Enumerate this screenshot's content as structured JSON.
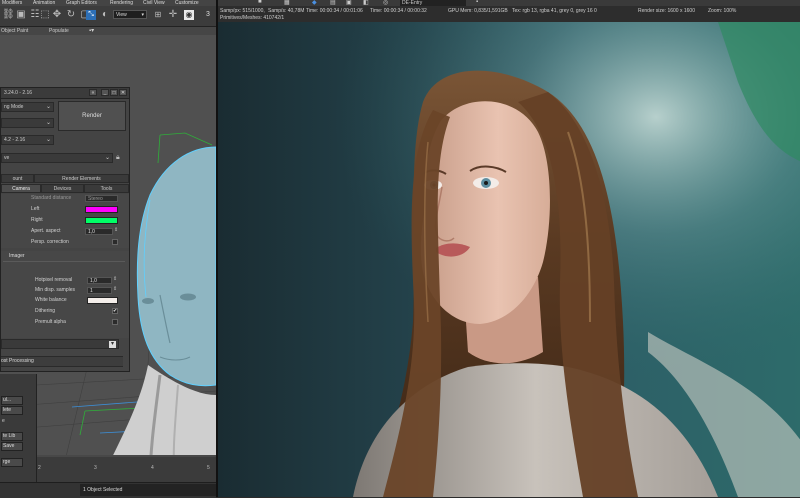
{
  "menubar": {
    "items": [
      "Modifiers",
      "Animation",
      "Graph Editors",
      "Rendering",
      "Civil View",
      "Customize"
    ]
  },
  "toolbar": {
    "view_select": "View",
    "frame_number": "3"
  },
  "ribbon": {
    "items": [
      "Object Paint",
      "Populate"
    ]
  },
  "viewport": {
    "ruler_ticks": [
      "2",
      "3",
      "4",
      "5"
    ]
  },
  "status": {
    "selection": "1 Object Selected"
  },
  "dialog": {
    "title": "3.24.0 - 2.16",
    "mode_dropdown": "ng Mode",
    "version_dropdown": "4.2 - 2.16",
    "preset_dropdown": "ve",
    "render_label": "Render",
    "tabs_row1": [
      "ount",
      "Render Elements"
    ],
    "tabs_row2": [
      "Camera",
      "Devices",
      "Tools"
    ],
    "stereo": {
      "rows": [
        {
          "label": "Standard distance",
          "value": "Stereo"
        },
        {
          "label": "Left",
          "color": "#ff00ff"
        },
        {
          "label": "Right",
          "color": "#00ff66"
        },
        {
          "label": "Apert. aspect",
          "value": "1,0"
        },
        {
          "label": "Persp. correction"
        }
      ]
    },
    "imager": {
      "section_label": "Imager",
      "hotpixel_label": "Hotpixel removal",
      "hotpixel_value": "1,0",
      "min_samples_label": "Min disp. samples",
      "min_samples_value": "1",
      "white_balance_label": "White balance",
      "dithering_label": "Dithering",
      "premult_label": "Premult alpha"
    },
    "post_processing_label": "ost Processing"
  },
  "left_panel": {
    "buttons": [
      "ul...",
      "lete",
      "e",
      "te Lib",
      "Save",
      "rge"
    ]
  },
  "frame": {
    "status_text": "DE-Entry",
    "info": {
      "samp_px": "Samp/px: 515/1000,",
      "samp_s": "Samp/s: 40,78M",
      "time": "Time: 00:00:34 / 00:01:06",
      "time2": "Time: 00:00:34 / 00:00:32",
      "gpu": "GPU Mem: 0,835/1,591GB",
      "tex": "Tex: rgb 13, rgba 41, grey 0, grey 16 0",
      "render_size": "Render size: 1600 x 1600",
      "zoom": "Zoom: 100%",
      "primitives": "Primitives/Meshes: 410742/1"
    }
  }
}
